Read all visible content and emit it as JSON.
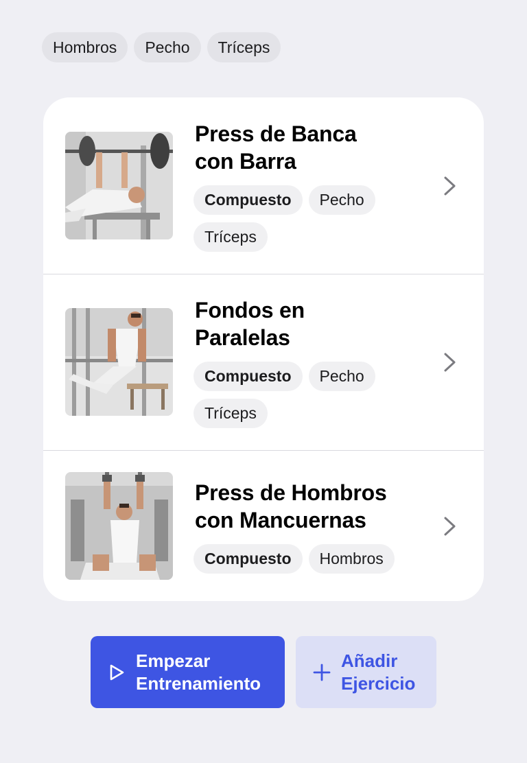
{
  "filters": [
    "Hombros",
    "Pecho",
    "Tríceps"
  ],
  "exercises": [
    {
      "title_line1": "Press de Banca",
      "title_line2": "con Barra",
      "tags": [
        "Compuesto",
        "Pecho",
        "Tríceps"
      ],
      "image": "bench-press-photo"
    },
    {
      "title_line1": "Fondos en",
      "title_line2": "Paralelas",
      "tags": [
        "Compuesto",
        "Pecho",
        "Tríceps"
      ],
      "image": "parallel-dips-photo"
    },
    {
      "title_line1": "Press de Hombros",
      "title_line2": "con Mancuernas",
      "tags": [
        "Compuesto",
        "Hombros"
      ],
      "image": "dumbbell-shoulder-press-photo"
    }
  ],
  "actions": {
    "start": {
      "line1": "Empezar",
      "line2": "Entrenamiento",
      "icon": "play-icon"
    },
    "add": {
      "line1": "Añadir",
      "line2": "Ejercicio",
      "icon": "plus-icon"
    }
  },
  "colors": {
    "accent": "#3e55e3",
    "accent_soft": "#dcdff6",
    "background": "#efeff4"
  }
}
